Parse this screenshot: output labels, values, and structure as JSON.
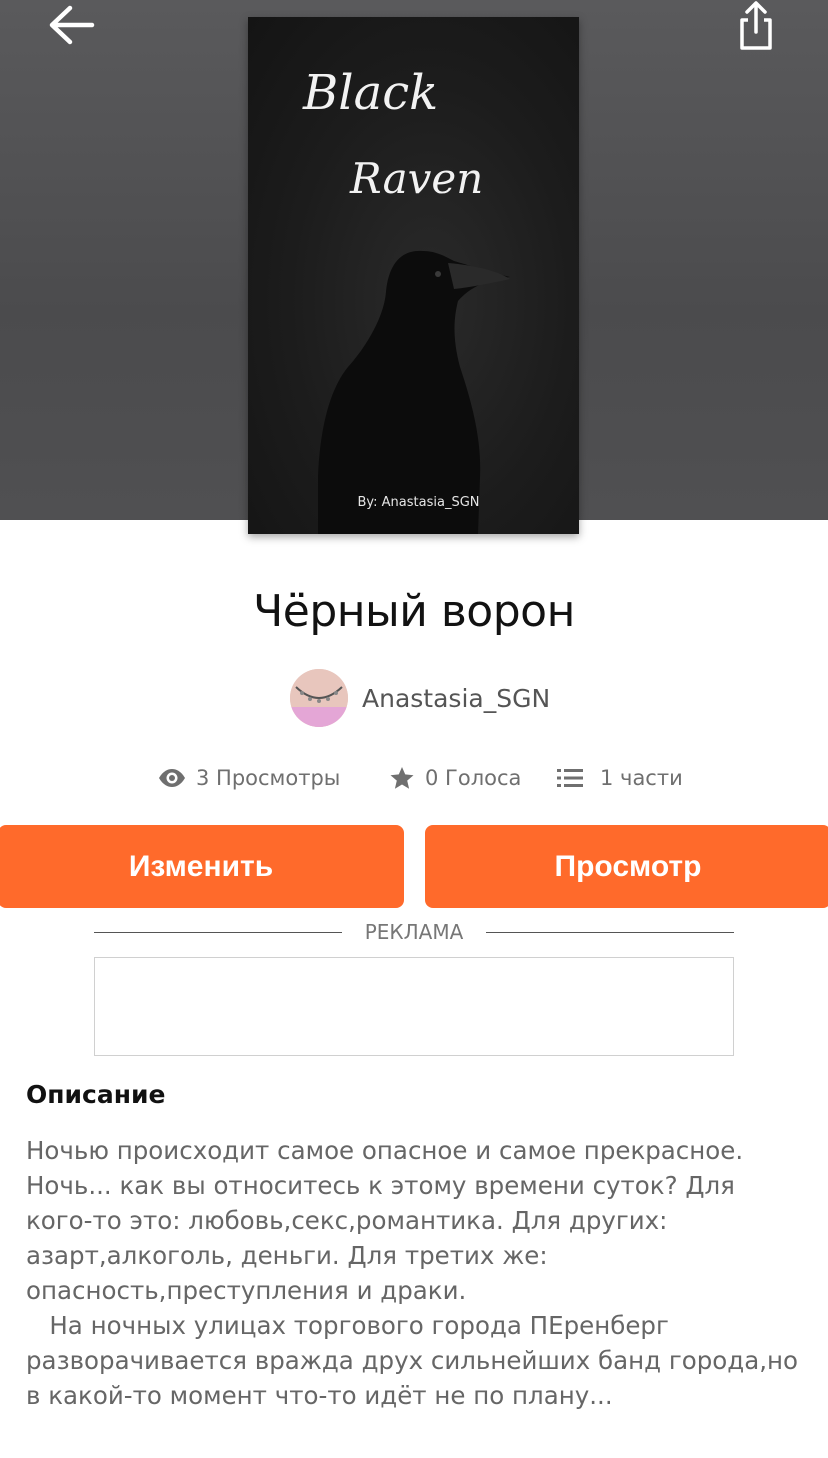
{
  "header": {
    "back_icon": "arrow-left-icon",
    "share_icon": "share-icon"
  },
  "cover": {
    "title_line1": "Black",
    "title_line2": "Raven",
    "author": "By: Anastasia_SGN"
  },
  "story": {
    "title": "Чёрный ворон",
    "author_name": "Anastasia_SGN"
  },
  "stats": {
    "views": "3 Просмотры",
    "votes": "0 Голоса",
    "parts": "1 части"
  },
  "actions": {
    "edit_label": "Изменить",
    "view_label": "Просмотр"
  },
  "ad": {
    "label": "РЕКЛАМА"
  },
  "description": {
    "heading": "Описание",
    "text": "Ночью происходит самое опасное и самое прекрасное. Ночь... как вы относитесь к этому времени суток? Для кого-то это: любовь,секс,романтика. Для других: азарт,алкоголь, деньги. Для третих же: опасность,преступления и драки.\n   На ночных улицах торгового города ПЕренберг разворачивается вражда друх сильнейших банд города,но в какой-то момент что-то идёт не по плану..."
  },
  "colors": {
    "accent": "#ff6a2b",
    "header_bg": "#4e4e50"
  }
}
